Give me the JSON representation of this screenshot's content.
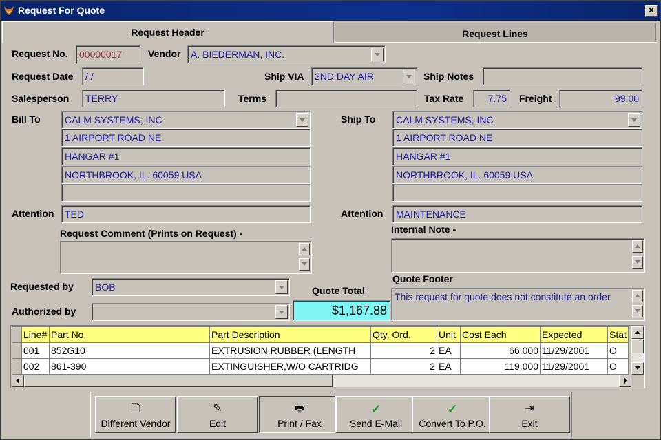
{
  "window": {
    "title": "Request For Quote",
    "close": "×"
  },
  "tabs": {
    "header": "Request Header",
    "lines": "Request Lines"
  },
  "labels": {
    "request_no": "Request No.",
    "vendor": "Vendor",
    "request_date": "Request Date",
    "ship_via": "Ship VIA",
    "ship_notes": "Ship Notes",
    "salesperson": "Salesperson",
    "terms": "Terms",
    "tax_rate": "Tax Rate",
    "freight": "Freight",
    "bill_to": "Bill To",
    "ship_to": "Ship To",
    "attention": "Attention",
    "request_comment": "Request Comment (Prints on Request) -",
    "internal_note": "Internal Note -",
    "requested_by": "Requested by",
    "authorized_by": "Authorized by",
    "quote_total": "Quote Total",
    "quote_footer": "Quote Footer"
  },
  "values": {
    "request_no": "00000017",
    "vendor": "A. BIEDERMAN, INC.",
    "request_date": " / /",
    "ship_via": "2ND DAY AIR",
    "ship_notes": "",
    "salesperson": "TERRY",
    "terms": "",
    "tax_rate": "7.75",
    "freight": "99.00",
    "bill_to": [
      "CALM SYSTEMS, INC",
      "1 AIRPORT ROAD NE",
      "HANGAR #1",
      "NORTHBROOK, IL.  60059  USA",
      ""
    ],
    "ship_to": [
      "CALM SYSTEMS, INC",
      "1 AIRPORT ROAD NE",
      "HANGAR #1",
      "NORTHBROOK, IL.  60059  USA",
      ""
    ],
    "bill_attention": "TED",
    "ship_attention": "MAINTENANCE",
    "request_comment": "",
    "internal_note": "",
    "requested_by": "BOB",
    "authorized_by": "",
    "quote_total": "$1,167.88",
    "quote_footer": "This request for quote does not constitute an order"
  },
  "grid": {
    "columns": [
      "Line#",
      "Part No.",
      "Part Description",
      "Qty. Ord.",
      "Unit",
      "Cost Each",
      "Expected",
      "Stat"
    ],
    "rows": [
      [
        "001",
        "852G10",
        "EXTRUSION,RUBBER (LENGTH",
        "2",
        "EA",
        "66.000",
        "11/29/2001",
        "O"
      ],
      [
        "002",
        "861-390",
        "EXTINGUISHER,W/O CARTRIDG",
        "2",
        "EA",
        "119.000",
        "11/29/2001",
        "O"
      ]
    ]
  },
  "toolbar": {
    "different_vendor": "Different Vendor",
    "edit": "Edit",
    "print_fax": "Print / Fax",
    "send_email": "Send E-Mail",
    "convert_po": "Convert To P.O.",
    "exit": "Exit"
  },
  "colors": {
    "title_bar": "#0a246a",
    "field_text": "#1a1aa0",
    "total_bg": "#7ff7f7",
    "grid_header": "#ffff80"
  }
}
